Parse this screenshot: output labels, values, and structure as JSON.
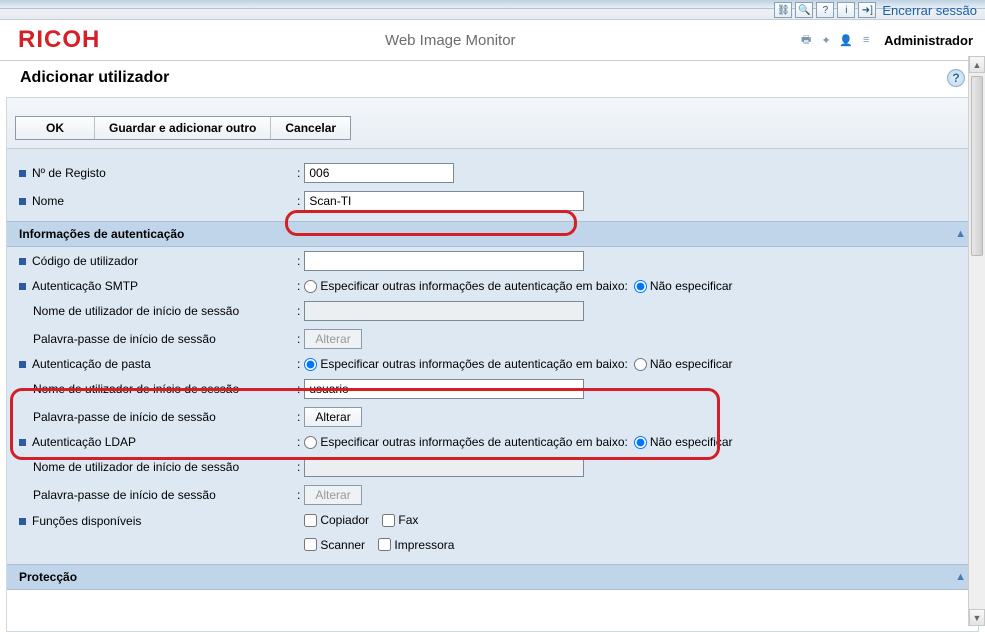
{
  "topbar": {
    "logout": "Encerrar sessão"
  },
  "header": {
    "logo": "RICOH",
    "subtitle": "Web Image Monitor",
    "role": "Administrador"
  },
  "page": {
    "title": "Adicionar utilizador"
  },
  "buttons": {
    "ok": "OK",
    "save_add": "Guardar e adicionar outro",
    "cancel": "Cancelar"
  },
  "fields": {
    "reg_no_label": "Nº de Registo",
    "reg_no_value": "006",
    "name_label": "Nome",
    "name_value": "Scan-TI"
  },
  "auth": {
    "section_title": "Informações de autenticação",
    "user_code_label": "Código de utilizador",
    "user_code_value": "",
    "specify_below": "Especificar outras informações de autenticação em baixo:",
    "not_specify": "Não especificar",
    "smtp_label": "Autenticação SMTP",
    "username_label": "Nome de utilizador de início de sessão",
    "password_label": "Palavra-passe de início de sessão",
    "change_btn": "Alterar",
    "folder_label": "Autenticação de pasta",
    "folder_user_value": "usuario",
    "ldap_label": "Autenticação LDAP",
    "funcs_label": "Funções disponíveis",
    "func_copier": "Copiador",
    "func_fax": "Fax",
    "func_scanner": "Scanner",
    "func_printer": "Impressora"
  },
  "protection": {
    "section_title": "Protecção"
  }
}
